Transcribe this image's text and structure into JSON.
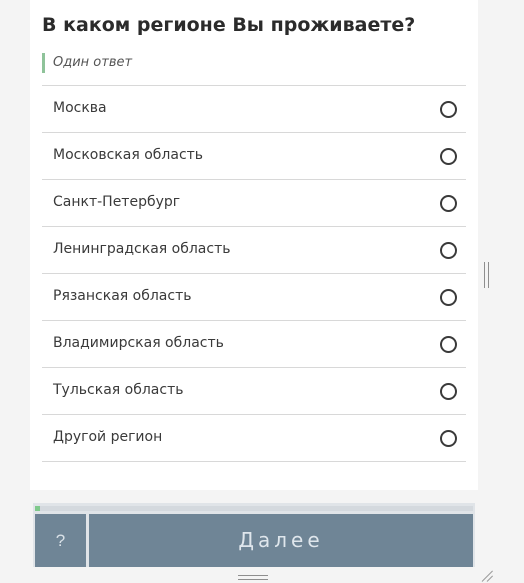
{
  "question": {
    "title": "В каком регионе Вы проживаете?",
    "hint": "Один ответ"
  },
  "options": [
    {
      "label": "Москва",
      "selected": false
    },
    {
      "label": "Московская область",
      "selected": false
    },
    {
      "label": "Санкт-Петербург",
      "selected": false
    },
    {
      "label": "Ленинградская область",
      "selected": false
    },
    {
      "label": "Рязанская область",
      "selected": false
    },
    {
      "label": "Владимирская область",
      "selected": false
    },
    {
      "label": "Тульская область",
      "selected": false
    },
    {
      "label": "Другой регион",
      "selected": false
    }
  ],
  "footer": {
    "help_label": "?",
    "next_label": "Далее",
    "progress": 0.012
  },
  "colors": {
    "accent": "#7fc98b",
    "button": "#6f8596",
    "divider": "#d8d8d8"
  }
}
